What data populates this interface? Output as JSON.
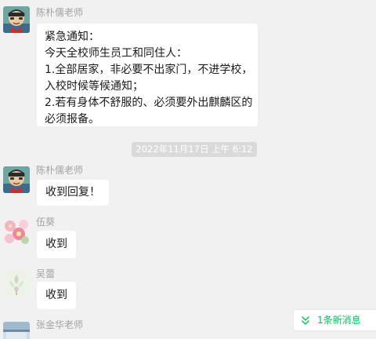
{
  "messages": [
    {
      "sender": "陈朴儒老师",
      "lines": [
        "紧急通知：",
        "今天全校师生员工和同住人：",
        "1.全部居家，非必要不出家门，不进学校，",
        "入校时候等候通知；",
        "2.若有身体不舒服的、必须要外出麒麟区的",
        "必须报备。"
      ]
    },
    {
      "sender": "陈朴儒老师",
      "text": "收到回复！"
    },
    {
      "sender": "伍葵",
      "text": "收到"
    },
    {
      "sender": "吴蕾",
      "text": "收到"
    },
    {
      "sender": "张金华老师"
    }
  ],
  "timestamp": "2022年11月17日 上午 6:12",
  "new_messages": {
    "label": "1条新消息",
    "icon": "double-chevron-down-icon",
    "color": "#07c160"
  },
  "colors": {
    "background": "#f1f1f1",
    "bubble": "#ffffff",
    "timestamp_bg": "#dadada",
    "sender_text": "#a3a3a3"
  }
}
